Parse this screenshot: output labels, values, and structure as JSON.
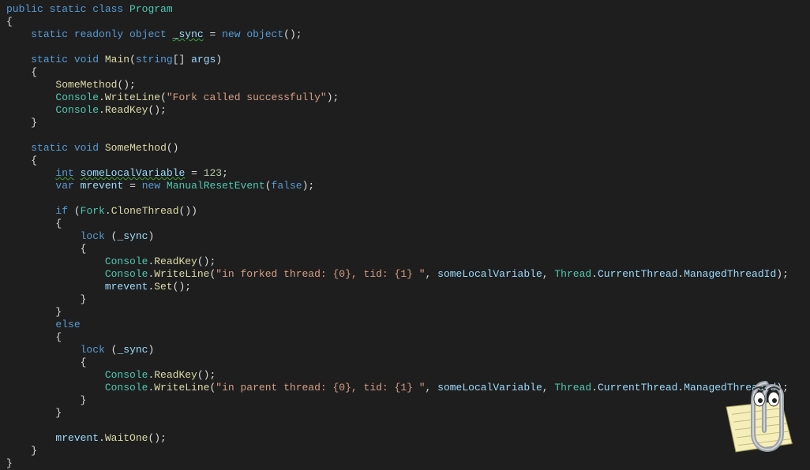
{
  "code": {
    "class_mods": "public static class",
    "class_name": "Program",
    "sync_decl_pre": "static readonly object",
    "sync_name": "_sync",
    "sync_new": "new object",
    "main_decl": "static void",
    "main_name": "Main",
    "main_param_type": "string",
    "main_param_name": "args",
    "call_somemethod": "SomeMethod",
    "console": "Console",
    "writeline": "WriteLine",
    "readkey": "ReadKey",
    "str_fork_called": "\"Fork called successfully\"",
    "sm_decl": "static void",
    "sm_name": "SomeMethod",
    "int_kw": "int",
    "local_var": "someLocalVariable",
    "local_val": "123",
    "var_kw": "var",
    "mrevent": "mrevent",
    "new_kw": "new",
    "mre_type": "ManualResetEvent",
    "false_kw": "false",
    "if_kw": "if",
    "fork": "Fork",
    "clonethread": "CloneThread",
    "lock_kw": "lock",
    "str_forked": "\"in forked thread: {0}, tid: {1} \"",
    "str_parent": "\"in parent thread: {0}, tid: {1} \"",
    "thread": "Thread",
    "currentthread": "CurrentThread",
    "managedtid": "ManagedThreadId",
    "set_fn": "Set",
    "else_kw": "else",
    "waitone": "WaitOne"
  },
  "assistant": {
    "name": "office-assistant-clippy"
  }
}
